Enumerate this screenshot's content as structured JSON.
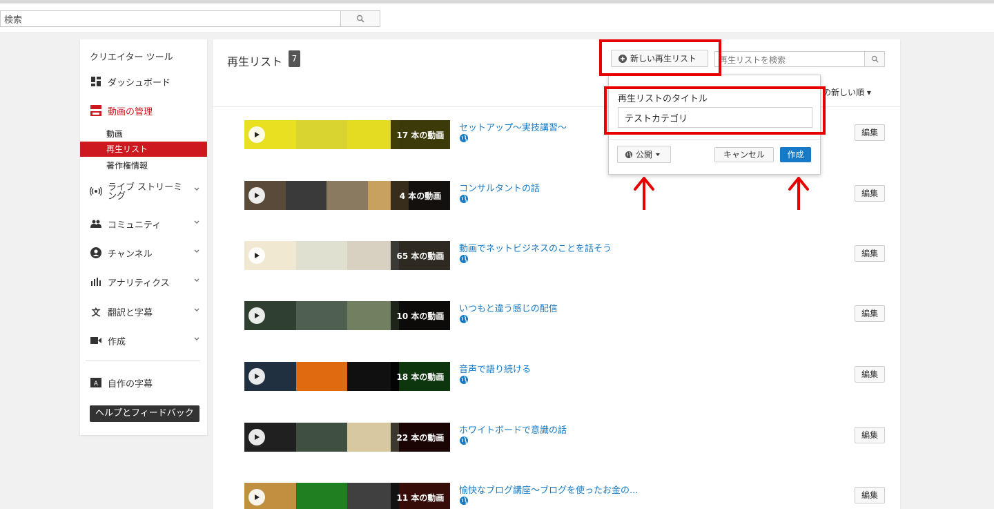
{
  "topbar": {
    "search_placeholder": "検索"
  },
  "sidebar": {
    "title": "クリエイター ツール",
    "items": [
      {
        "label": "ダッシュボード",
        "icon": "dashboard-icon"
      },
      {
        "label": "動画の管理",
        "icon": "video-manager-icon"
      },
      {
        "label": "ライブ ストリーミング",
        "icon": "live-icon"
      },
      {
        "label": "コミュニティ",
        "icon": "community-icon"
      },
      {
        "label": "チャンネル",
        "icon": "channel-icon"
      },
      {
        "label": "アナリティクス",
        "icon": "analytics-icon"
      },
      {
        "label": "翻訳と字幕",
        "icon": "translate-icon"
      },
      {
        "label": "作成",
        "icon": "create-icon"
      },
      {
        "label": "自作の字幕",
        "icon": "subtitles-icon"
      }
    ],
    "sub_items": [
      "動画",
      "再生リスト",
      "著作権情報"
    ],
    "help_label": "ヘルプとフィードバック"
  },
  "main": {
    "title": "再生リスト",
    "count": "7",
    "new_playlist_label": "新しい再生リスト",
    "search_placeholder": "再生リストを検索",
    "sort_label": "の新しい順 ▾",
    "edit_label": "編集"
  },
  "playlists": [
    {
      "title": "セットアップ～実技講習～",
      "count_label": "17 本の動画"
    },
    {
      "title": "コンサルタントの話",
      "count_label": "4 本の動画"
    },
    {
      "title": "動画でネットビジネスのことを話そう",
      "count_label": "65 本の動画"
    },
    {
      "title": "いつもと違う感じの配信",
      "count_label": "10 本の動画"
    },
    {
      "title": "音声で語り続ける",
      "count_label": "18 本の動画"
    },
    {
      "title": "ホワイトボードで意識の話",
      "count_label": "22 本の動画"
    },
    {
      "title": "愉快なブログ講座～ブログを使ったお金の...",
      "count_label": "11 本の動画"
    }
  ],
  "popup": {
    "title_label": "再生リストのタイトル",
    "title_value": "テストカテゴリ",
    "privacy_label": "公開",
    "cancel_label": "キャンセル",
    "create_label": "作成"
  },
  "colors": {
    "accent": "#cc181e",
    "link": "#167ac6",
    "annotation": "#e60000"
  }
}
